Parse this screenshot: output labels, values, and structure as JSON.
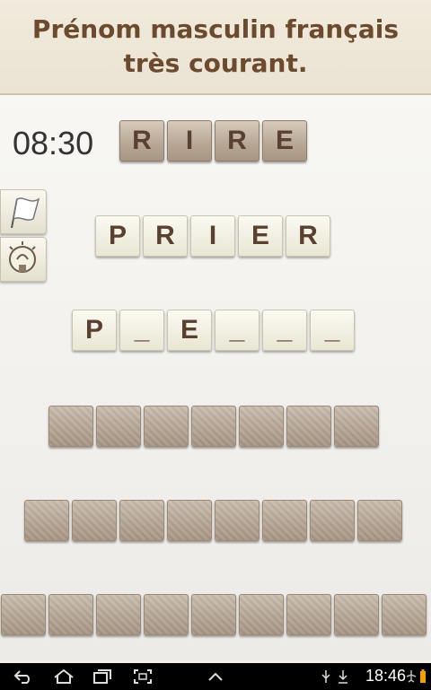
{
  "clue": {
    "text": "Prénom masculin français\ntrès courant."
  },
  "timer": "08:30",
  "rows": {
    "row1": [
      "R",
      "I",
      "R",
      "E"
    ],
    "row2": [
      "P",
      "R",
      "I",
      "E",
      "R"
    ],
    "row3": [
      "P",
      "_",
      "E",
      "_",
      "_",
      "_"
    ],
    "row4_count": 7,
    "row5_count": 8,
    "row6_count": 9
  },
  "side_buttons": [
    "flag-icon",
    "lightbulb-icon"
  ],
  "status_bar": {
    "time": "18:46",
    "icons": [
      "back-icon",
      "home-icon",
      "recent-apps-icon",
      "screenshot-icon",
      "up-chevron-icon",
      "usb-icon",
      "download-icon",
      "airplane-icon",
      "battery-icon"
    ]
  }
}
